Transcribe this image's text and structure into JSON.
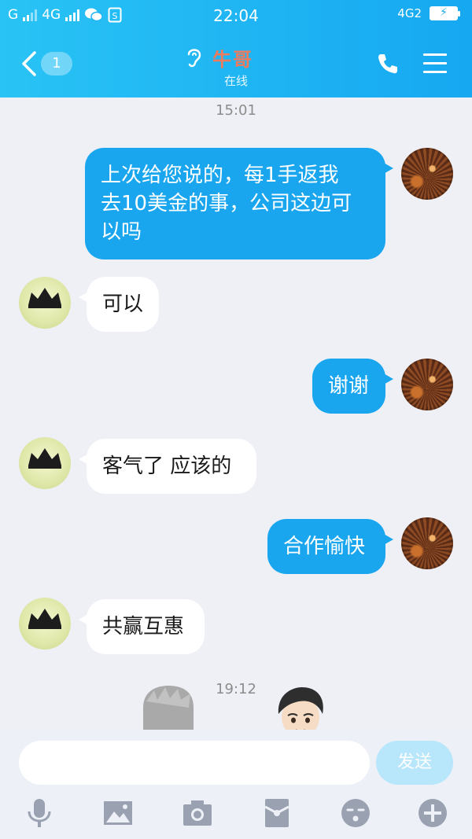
{
  "status_bar": {
    "carrier_left": "G",
    "network": "4G",
    "time": "22:04",
    "network_right": "4G2",
    "icons": [
      "signal-icon",
      "wechat-icon",
      "sim-icon",
      "battery-charging-icon"
    ]
  },
  "header": {
    "unread_count": "1",
    "contact_name": "牛哥",
    "contact_status": "在线",
    "icons": [
      "back-icon",
      "ear-icon",
      "phone-icon",
      "menu-icon"
    ]
  },
  "chat": {
    "timestamps": [
      "15:01",
      "19:12"
    ],
    "messages": [
      {
        "from": "me",
        "text_lines": [
          "上次给您说的，每1手返我",
          "去10美金的事，公司这边可",
          "以吗"
        ]
      },
      {
        "from": "other",
        "text": "可以"
      },
      {
        "from": "me",
        "text": "谢谢"
      },
      {
        "from": "other",
        "text": "客气了 应该的"
      },
      {
        "from": "me",
        "text": "合作愉快"
      },
      {
        "from": "other",
        "text": "共赢互惠"
      }
    ]
  },
  "input": {
    "placeholder": "",
    "send_label": "发送"
  },
  "toolbar": {
    "icons": [
      "microphone-icon",
      "image-icon",
      "camera-icon",
      "red-packet-icon",
      "emoji-icon",
      "plus-icon"
    ]
  },
  "colors": {
    "header": "#1aa8ef",
    "bubble_out": "#1aa6ef",
    "bubble_in": "#ffffff",
    "background": "#eef0f6",
    "name": "#f07a5c"
  }
}
